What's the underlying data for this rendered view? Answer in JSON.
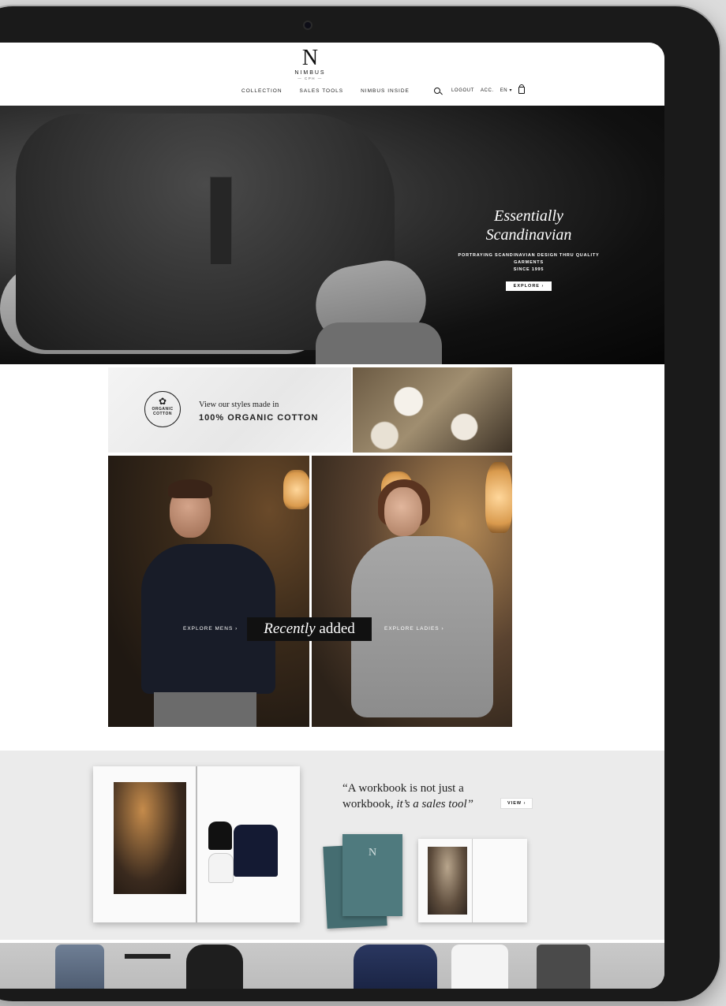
{
  "brand": {
    "mark": "N",
    "name": "NIMBUS",
    "sub": "— CPH —"
  },
  "nav": {
    "items": [
      "COLLECTION",
      "SALES TOOLS",
      "NIMBUS INSIDE"
    ]
  },
  "utils": {
    "logout": "LOGOUT",
    "account": "ACC.",
    "language": "EN ▾"
  },
  "hero": {
    "title": "Essentially Scandinavian",
    "subtitle_line1": "PORTRAYING SCANDINAVIAN DESIGN THRU QUALITY GARMENTS",
    "subtitle_line2": "SINCE 1995",
    "button": "EXPLORE ›"
  },
  "organic": {
    "badge_line1": "ORGANIC",
    "badge_line2": "COTTON",
    "line1": "View our styles made in",
    "line2": "100% ORGANIC COTTON"
  },
  "panels": {
    "mens_label": "EXPLORE MENS ›",
    "ladies_label": "EXPLORE LADIES ›",
    "recent_italic": "Recently",
    "recent_rest": " added"
  },
  "workbook": {
    "quote_line1": "“A workbook is not just a",
    "quote_line2_plain": "workbook, ",
    "quote_line2_italic": "it’s a sales tool”",
    "button": "VIEW ›"
  }
}
